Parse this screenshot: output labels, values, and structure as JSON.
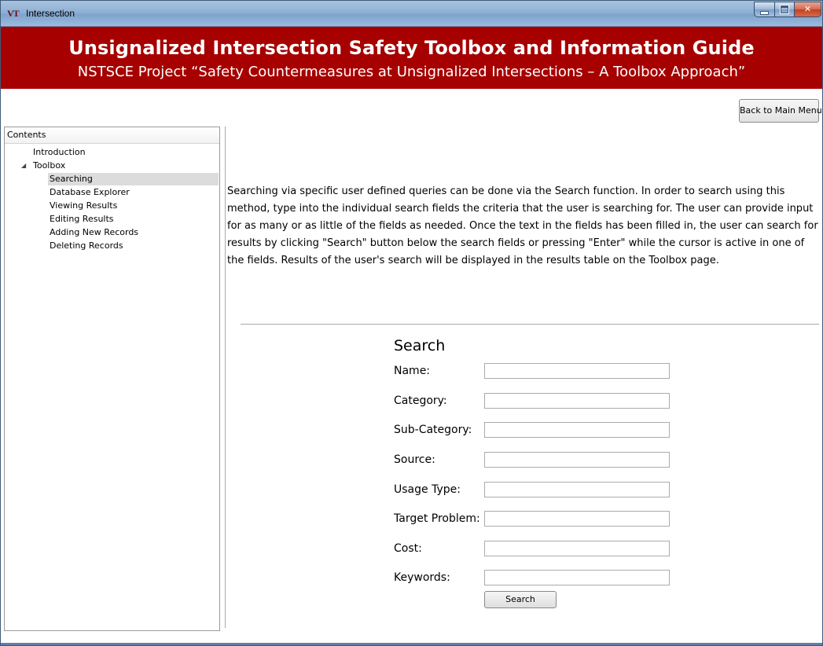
{
  "window": {
    "title": "Intersection",
    "app_icon": "VT",
    "controls": {
      "minimize": "minimize-icon",
      "maximize": "maximize-icon",
      "close": "close-icon"
    }
  },
  "banner": {
    "title": "Unsignalized Intersection Safety Toolbox and Information Guide",
    "subtitle": "NSTSCE Project “Safety Countermeasures at Unsignalized Intersections – A Toolbox Approach”",
    "background": "#a60000"
  },
  "toolbar": {
    "back_label": "Back to Main Menu"
  },
  "sidebar": {
    "header": "Contents",
    "items": [
      {
        "label": "Introduction"
      },
      {
        "label": "Toolbox",
        "expanded": true
      },
      {
        "label": "Searching",
        "selected": true
      },
      {
        "label": "Database Explorer"
      },
      {
        "label": "Viewing Results"
      },
      {
        "label": "Editing Results"
      },
      {
        "label": "Adding New Records"
      },
      {
        "label": "Deleting Records"
      }
    ]
  },
  "main": {
    "description": "Searching via specific user defined queries can be done via the Search function. In order to search using this method, type into the individual search fields the criteria that the user is searching for. The user can provide input for as many or as little of the fields as needed. Once the text in the fields has been filled in, the user can search for results by clicking \"Search\" button below the search fields or pressing \"Enter\" while the cursor is active in one of the fields. Results of the user's search will be displayed in the results table on the Toolbox page.",
    "search": {
      "heading": "Search",
      "fields": [
        {
          "label": "Name:",
          "value": ""
        },
        {
          "label": "Category:",
          "value": ""
        },
        {
          "label": "Sub-Category:",
          "value": ""
        },
        {
          "label": "Source:",
          "value": ""
        },
        {
          "label": "Usage Type:",
          "value": ""
        },
        {
          "label": "Target Problem:",
          "value": ""
        },
        {
          "label": "Cost:",
          "value": ""
        },
        {
          "label": "Keywords:",
          "value": ""
        }
      ],
      "button_label": "Search"
    }
  }
}
